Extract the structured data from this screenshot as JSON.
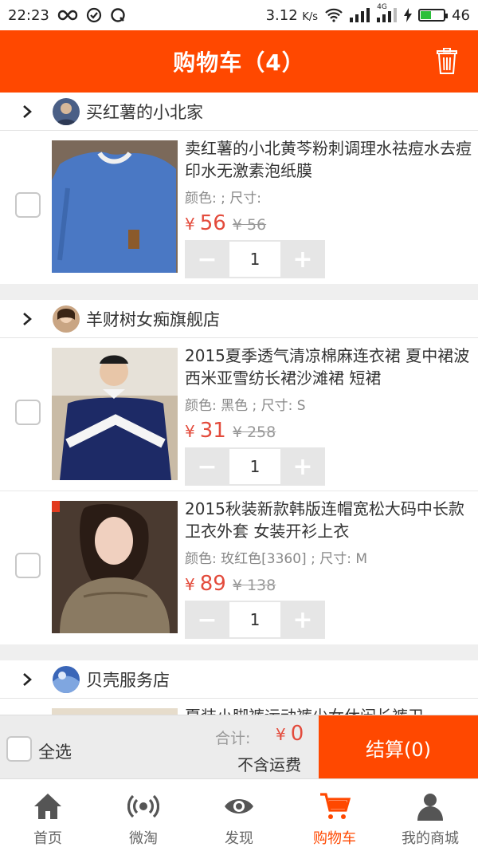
{
  "status_bar": {
    "time": "22:23",
    "speed": "3.12",
    "speed_unit": "K/s",
    "network": "4G",
    "battery": "46",
    "battery_level": 0.46
  },
  "header": {
    "title": "购物车（4）"
  },
  "shops": [
    {
      "name": "买红薯的小北家",
      "items": [
        {
          "title": "卖红薯的小北黄芩粉刺调理水祛痘水去痘印水无激素泡纸膜",
          "spec": "颜色: ; 尺寸: ",
          "price": "56",
          "orig_price": "¥ 56",
          "qty": "1"
        }
      ]
    },
    {
      "name": "羊财树女痴旗舰店",
      "items": [
        {
          "title": "2015夏季透气清凉棉麻连衣裙 夏中裙波西米亚雪纺长裙沙滩裙 短裙",
          "spec": "颜色: 黑色 ; 尺寸: S",
          "price": "31",
          "orig_price": "¥ 258",
          "qty": "1"
        },
        {
          "title": "2015秋装新款韩版连帽宽松大码中长款卫衣外套 女装开衫上衣",
          "spec": "颜色: 玫红色[3360] ; 尺寸: M",
          "price": "89",
          "orig_price": "¥ 138",
          "qty": "1"
        }
      ]
    },
    {
      "name": "贝壳服务店",
      "items": [
        {
          "title": "夏装小脚裤运动裤少女休闲长裤卫"
        }
      ]
    }
  ],
  "currency": "¥",
  "checkout": {
    "select_all": "全选",
    "total_label": "合计:",
    "total_value": "0",
    "shipping_note": "不含运费",
    "pay_label": "结算(0)"
  },
  "tabs": [
    {
      "label": "首页",
      "icon": "home-icon"
    },
    {
      "label": "微淘",
      "icon": "broadcast-icon"
    },
    {
      "label": "发现",
      "icon": "eye-icon"
    },
    {
      "label": "购物车",
      "icon": "cart-icon",
      "active": true
    },
    {
      "label": "我的商城",
      "icon": "user-icon"
    }
  ],
  "colors": {
    "accent": "#ff4800",
    "price": "#e34b3c"
  }
}
